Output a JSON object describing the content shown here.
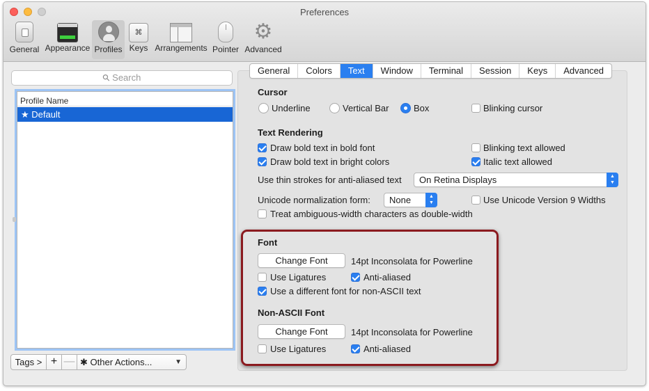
{
  "window": {
    "title": "Preferences"
  },
  "toolbar": {
    "items": [
      {
        "label": "General",
        "icon": "general-icon"
      },
      {
        "label": "Appearance",
        "icon": "appearance-icon"
      },
      {
        "label": "Profiles",
        "icon": "profiles-icon",
        "selected": true
      },
      {
        "label": "Keys",
        "icon": "keys-icon",
        "glyph": "⌘"
      },
      {
        "label": "Arrangements",
        "icon": "arrangements-icon"
      },
      {
        "label": "Pointer",
        "icon": "pointer-icon"
      },
      {
        "label": "Advanced",
        "icon": "gear-icon"
      }
    ]
  },
  "sidebar": {
    "search_placeholder": "Search",
    "list_header": "Profile Name",
    "profiles": [
      {
        "name": "★ Default",
        "selected": true
      }
    ],
    "bottom": {
      "tags": "Tags >",
      "plus": "+",
      "minus": "—",
      "other_actions": "Other Actions...",
      "gear": "✱"
    }
  },
  "tabs": [
    "General",
    "Colors",
    "Text",
    "Window",
    "Terminal",
    "Session",
    "Keys",
    "Advanced"
  ],
  "active_tab": "Text",
  "cursor": {
    "title": "Cursor",
    "options": [
      {
        "label": "Underline",
        "checked": false
      },
      {
        "label": "Vertical Bar",
        "checked": false
      },
      {
        "label": "Box",
        "checked": true
      }
    ],
    "blinking": {
      "label": "Blinking cursor",
      "checked": false
    }
  },
  "text_rendering": {
    "title": "Text Rendering",
    "bold_font": {
      "label": "Draw bold text in bold font",
      "checked": true
    },
    "bright_colors": {
      "label": "Draw bold text in bright colors",
      "checked": true
    },
    "blinking_text": {
      "label": "Blinking text allowed",
      "checked": false
    },
    "italic_text": {
      "label": "Italic text allowed",
      "checked": true
    },
    "thin_strokes_label": "Use thin strokes for anti-aliased text",
    "thin_strokes_value": "On Retina Displays",
    "unicode_norm_label": "Unicode normalization form:",
    "unicode_norm_value": "None",
    "unicode_v9": {
      "label": "Use Unicode Version 9 Widths",
      "checked": false
    },
    "ambiguous": {
      "label": "Treat ambiguous-width characters as double-width",
      "checked": false
    }
  },
  "font": {
    "title": "Font",
    "change_button": "Change Font",
    "font_name": "14pt Inconsolata for Powerline",
    "ligatures": {
      "label": "Use Ligatures",
      "checked": false
    },
    "anti_aliased": {
      "label": "Anti-aliased",
      "checked": true
    },
    "non_ascii_toggle": {
      "label": "Use a different font for non-ASCII text",
      "checked": true
    }
  },
  "non_ascii_font": {
    "title": "Non-ASCII Font",
    "change_button": "Change Font",
    "font_name": "14pt Inconsolata for Powerline",
    "ligatures": {
      "label": "Use Ligatures",
      "checked": false
    },
    "anti_aliased": {
      "label": "Anti-aliased",
      "checked": true
    }
  },
  "colors": {
    "accent": "#2a7ff0",
    "selection": "#1866d5",
    "highlight_border": "#8b1a1f"
  }
}
